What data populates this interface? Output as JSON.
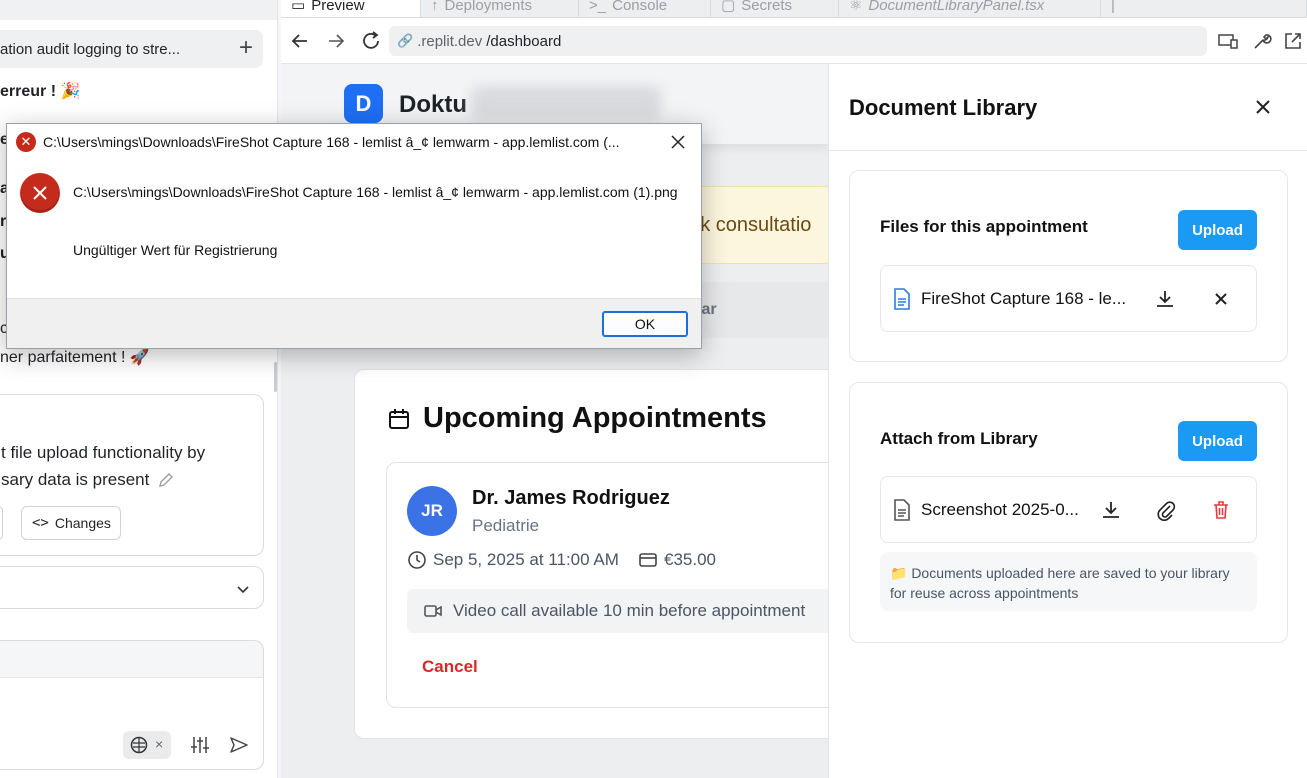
{
  "left_panel": {
    "chat_title": "ation audit logging to stre...",
    "line1": "erreur ! 🎉",
    "line2": "ner parfaitement ! 🚀",
    "frag_e": "e",
    "frag_a": "a",
    "frag_r": "r",
    "frag_u": "u",
    "frag_c": "c",
    "card_text_1": "t file upload functionality by",
    "card_text_2": "sary data is present",
    "changes_label": "Changes"
  },
  "browser": {
    "tabs": [
      "Preview",
      "Deployments",
      "Console",
      "Secrets",
      "DocumentLibraryPanel.tsx"
    ],
    "url_host": ".replit.dev",
    "url_path": "/dashboard"
  },
  "page": {
    "logo_letter": "D",
    "brand": "Doktu",
    "banner_text": "ook consultatio",
    "tab_text": "lar",
    "appointments_title": "Upcoming Appointments",
    "doctor_initials": "JR",
    "doctor_name": "Dr. James Rodriguez",
    "specialty": "Pediatrie",
    "datetime": "Sep 5, 2025 at 11:00 AM",
    "price": "€35.00",
    "video_note": "Video call available 10 min before appointment",
    "cancel_label": "Cancel"
  },
  "doc_panel": {
    "title": "Document Library",
    "section1_title": "Files for this appointment",
    "section1_upload": "Upload",
    "section1_file": "FireShot Capture 168 - le...",
    "section2_title": "Attach from Library",
    "section2_upload": "Upload",
    "section2_file": "Screenshot 2025-0...",
    "info_note": "📁 Documents uploaded here are saved to your library for reuse across appointments",
    "accent_color": "#1a9af2",
    "delete_color": "#e03b3b"
  },
  "dialog": {
    "title": "C:\\Users\\mings\\Downloads\\FireShot Capture 168 - lemlist â_¢ lemwarm - app.lemlist.com (...",
    "message": "C:\\Users\\mings\\Downloads\\FireShot Capture 168 - lemlist â_¢ lemwarm - app.lemlist.com (1).png",
    "detail": "Ungültiger Wert für Registrierung",
    "ok_label": "OK"
  }
}
